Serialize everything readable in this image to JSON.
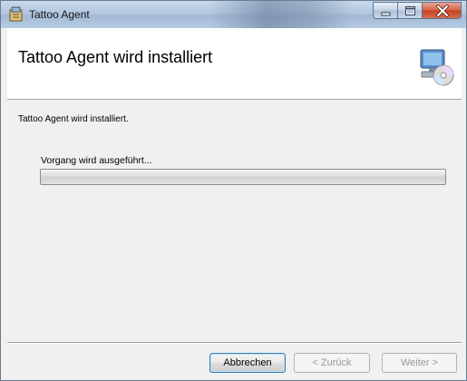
{
  "window": {
    "title": "Tattoo Agent"
  },
  "banner": {
    "title": "Tattoo Agent wird installiert",
    "icon": "installer-computer-disc-icon"
  },
  "content": {
    "status_text": "Tattoo Agent wird installiert.",
    "progress_label": "Vorgang wird ausgeführt...",
    "progress_fraction": 0
  },
  "buttons": {
    "cancel": "Abbrechen",
    "back": "< Zurück",
    "next": "Weiter >"
  },
  "colors": {
    "titlebar": "#b2c7df",
    "close_button": "#c2401f",
    "default_button_border": "#3c7fb1"
  }
}
